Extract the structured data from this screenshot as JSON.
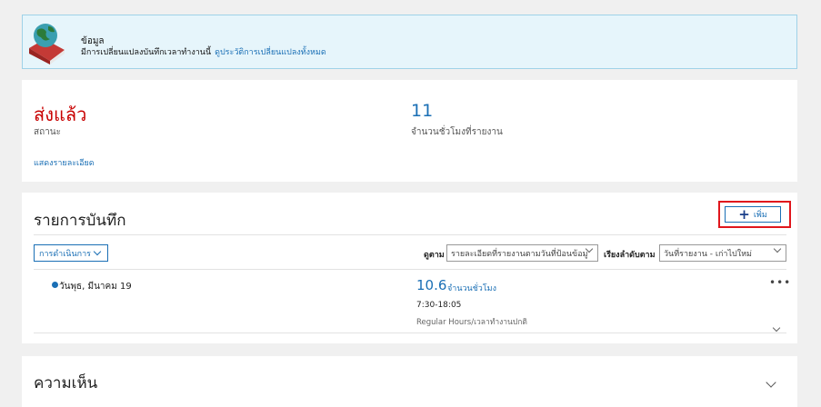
{
  "info_banner": {
    "title": "ข้อมูล",
    "message": "มีการเปลี่ยนแปลงบันทึกเวลาทำงานนี้",
    "link": "ดูประวัติการเปลี่ยนแปลงทั้งหมด",
    "icon": "book-globe-icon"
  },
  "summary": {
    "status_value": "ส่งแล้ว",
    "status_label": "สถานะ",
    "hours_value": "11",
    "hours_label": "จำนวนชั่วโมงที่รายงาน",
    "details_link": "แสดงรายละเอียด"
  },
  "records": {
    "title": "รายการบันทึก",
    "add_label": "เพิ่ม",
    "actions_label": "การดำเนินการ",
    "view_label": "ดูตาม",
    "view_value": "รายละเอียดที่รายงานตามวันที่ป้อนข้อมู",
    "sort_label": "เรียงลำดับตาม",
    "sort_value": "วันที่รายงาน - เก่าไปใหม่",
    "entries": [
      {
        "day": "วันพุธ, มีนาคม 19",
        "hours": "10.6",
        "hours_label": "จำนวนชั่วโมง",
        "time_range": "7:30-18:05",
        "pay_type": "Regular Hours/เวลาทำงานปกติ",
        "more": "•••"
      }
    ]
  },
  "comments": {
    "title": "ความเห็น"
  },
  "colors": {
    "accent": "#1a6fb5",
    "status": "#c80000",
    "highlight": "#e0161c",
    "banner_bg": "#e6f5fb"
  }
}
